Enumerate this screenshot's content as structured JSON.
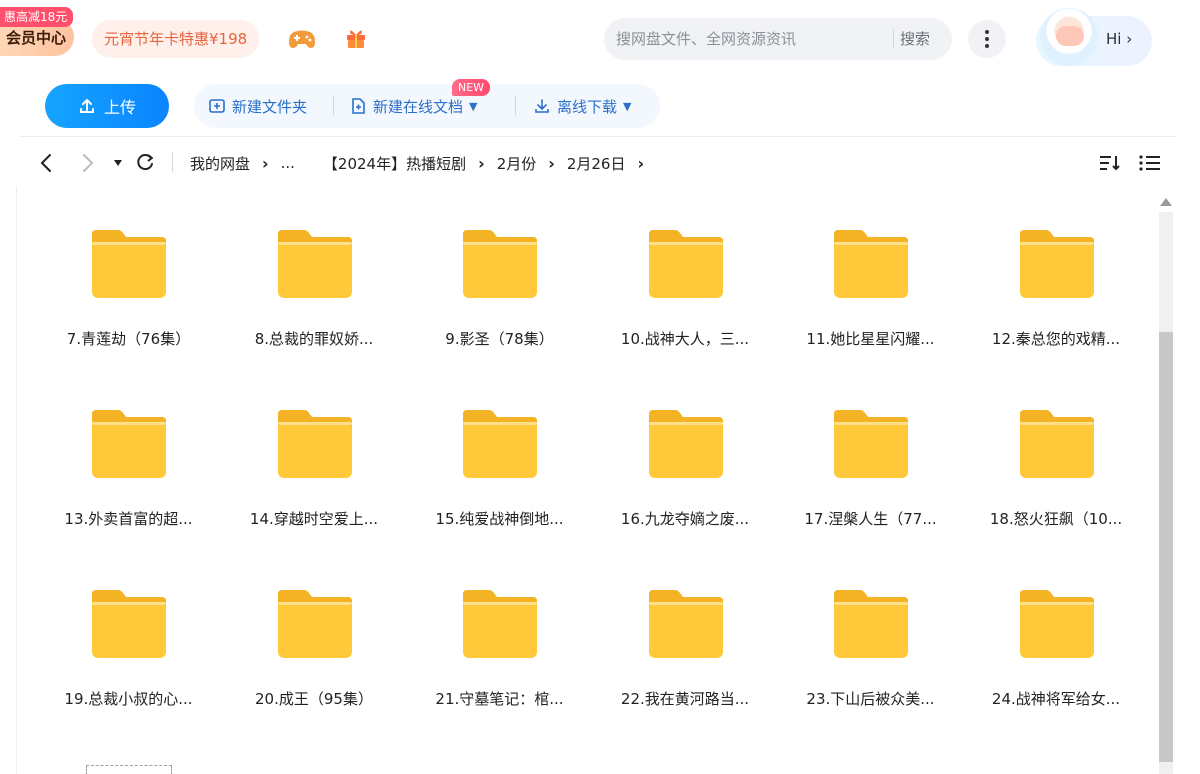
{
  "header": {
    "vip_badge": "惠高减18元",
    "vip_label": "会员中心",
    "promo_label": "元宵节年卡特惠¥198",
    "search_placeholder": "搜网盘文件、全网资源资讯",
    "search_button": "搜索",
    "user_greeting": "Hi",
    "icons": [
      "game-icon",
      "gift-icon",
      "more-icon",
      "avatar"
    ]
  },
  "toolbar": {
    "upload_label": "上传",
    "new_folder_label": "新建文件夹",
    "new_doc_label": "新建在线文档",
    "new_badge": "NEW",
    "offline_download_label": "离线下载",
    "accent_color": "#0a84ff",
    "tool_color": "#2b6fc8"
  },
  "breadcrumb": {
    "items": [
      "我的网盘",
      "...",
      "【2024年】热播短剧",
      "2月份",
      "2月26日"
    ]
  },
  "files": {
    "items": [
      "7.青莲劫（76集）",
      "8.总裁的罪奴娇...",
      "9.影圣（78集）",
      "10.战神大人，三...",
      "11.她比星星闪耀...",
      "12.秦总您的戏精...",
      "13.外卖首富的超...",
      "14.穿越时空爱上...",
      "15.纯爱战神倒地...",
      "16.九龙夺嫡之废...",
      "17.涅槃人生（77...",
      "18.怒火狂飙（10...",
      "19.总裁小叔的心...",
      "20.成王（95集）",
      "21.守墓笔记：棺...",
      "22.我在黄河路当...",
      "23.下山后被众美...",
      "24.战神将军给女..."
    ],
    "folder_color": "#ffc93a"
  }
}
